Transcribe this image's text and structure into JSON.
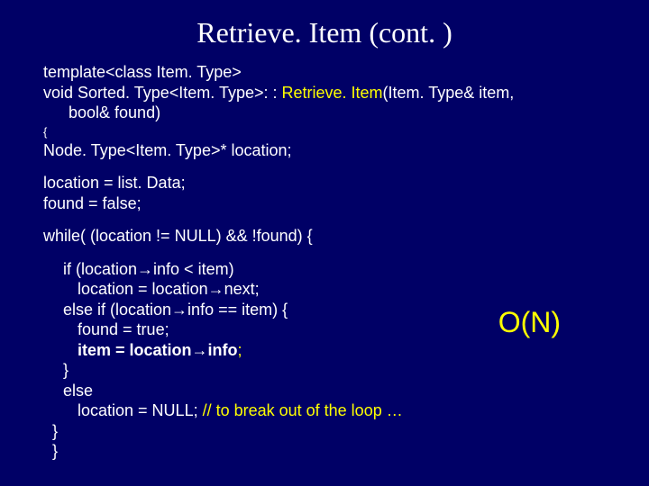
{
  "title": "Retrieve. Item (cont. )",
  "code": {
    "sig1": "template<class Item. Type>",
    "sig2a": "void Sorted. Type<Item. Type>: : ",
    "sig2b": "Retrieve. Item",
    "sig2c": "(Item. Type& item,",
    "sig3": "bool& found)",
    "openBrace": "{",
    "decl": "Node. Type<Item. Type>* location;",
    "assign1": "location = list. Data;",
    "assign2": "found = false;",
    "whileLine": "while( (location != NULL) && !found) {",
    "ifLine": "if (location→info < item)",
    "ifBody": "location = location→next;",
    "elseIfLine": "else if (location→info == item) {",
    "foundTrue": "found = true;",
    "itemAssignA": "item = location→info",
    "itemAssignB": ";",
    "closeBrace1": "}",
    "elseLine": "else",
    "elseBodyA": "location = NULL;  ",
    "elseBodyB": "// to break out of the loop …",
    "closeBrace2": "}",
    "closeBrace3": "}"
  },
  "annotation": "O(N)"
}
